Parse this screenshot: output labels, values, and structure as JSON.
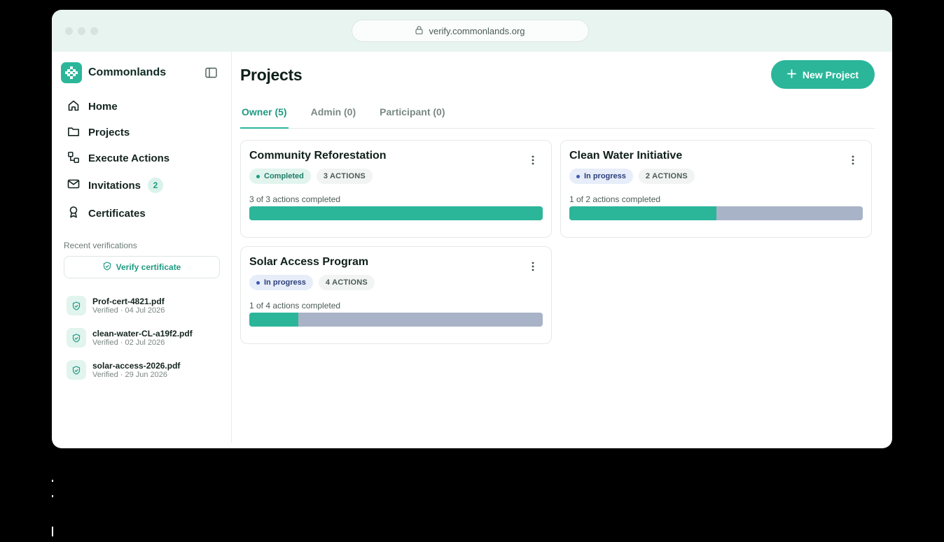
{
  "browser": {
    "url": "verify.commonlands.org"
  },
  "sidebar": {
    "brand": "Commonlands",
    "nav": [
      {
        "label": "Home",
        "icon": "home-icon"
      },
      {
        "label": "Projects",
        "icon": "folder-icon"
      },
      {
        "label": "Execute Actions",
        "icon": "workflow-icon"
      },
      {
        "label": "Invitations",
        "icon": "mail-icon",
        "badge": "2"
      },
      {
        "label": "Certificates",
        "icon": "award-icon"
      }
    ],
    "recent_label": "Recent verifications",
    "verify_label": "Verify certificate",
    "recent": [
      {
        "name": "Prof-cert-4821.pdf",
        "meta": "Verified · 04 Jul 2026"
      },
      {
        "name": "clean-water-CL-a19f2.pdf",
        "meta": "Verified · 02 Jul 2026"
      },
      {
        "name": "solar-access-2026.pdf",
        "meta": "Verified · 29 Jun 2026"
      }
    ]
  },
  "main": {
    "title": "Projects",
    "new_project_label": "New Project",
    "tabs": [
      {
        "label": "Owner (5)",
        "active": true
      },
      {
        "label": "Admin (0)",
        "active": false
      },
      {
        "label": "Participant (0)",
        "active": false
      }
    ],
    "projects": [
      {
        "title": "Community Reforestation",
        "status": "Completed",
        "status_type": "completed",
        "actions": "3 ACTIONS",
        "progress_text": "3 of 3 actions completed",
        "progress": 1.0
      },
      {
        "title": "Clean Water Initiative",
        "status": "In progress",
        "status_type": "progress",
        "actions": "2 ACTIONS",
        "progress_text": "1 of 2 actions completed",
        "progress": 0.5
      },
      {
        "title": "Solar Access Program",
        "status": "In progress",
        "status_type": "progress",
        "actions": "4 ACTIONS",
        "progress_text": "1 of 4 actions completed",
        "progress": 0.167
      }
    ]
  },
  "colors": {
    "accent": "#2bb69a",
    "bar_track": "#a8b3c7",
    "chrome": "#e8f4f0"
  }
}
